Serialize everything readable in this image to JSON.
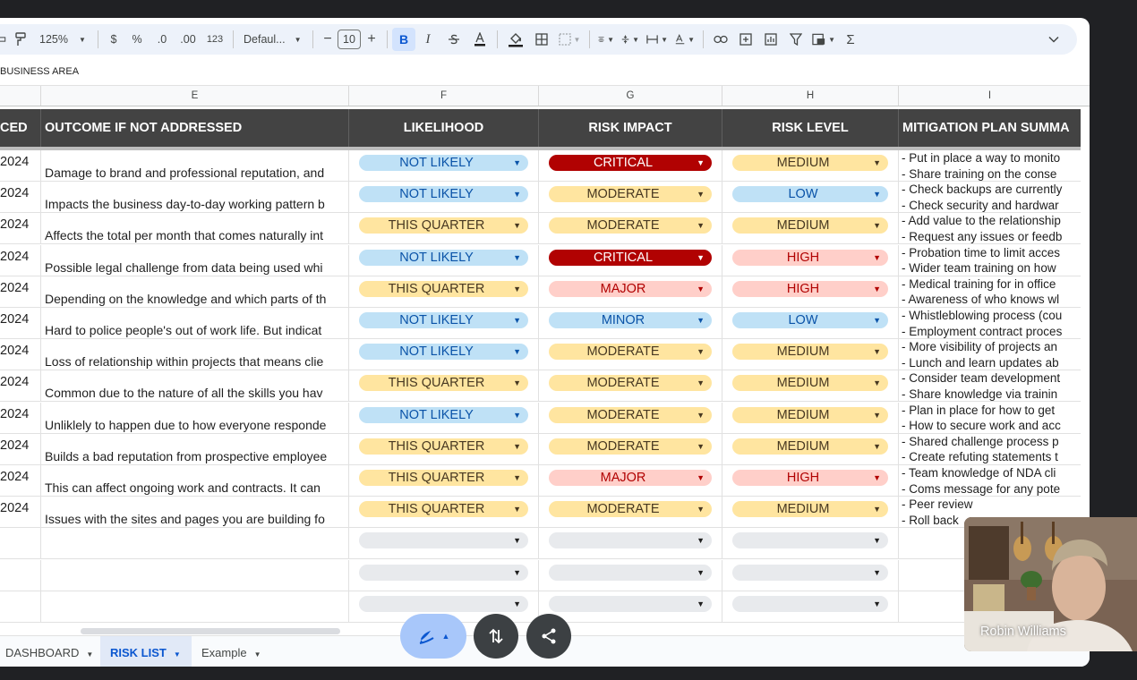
{
  "toolbar": {
    "zoom": "125%",
    "currency": "$",
    "percent": "%",
    "decrease_decimal": ".0",
    "increase_decimal": ".00",
    "number_format": "123",
    "font": "Defaul...",
    "minus": "−",
    "font_size": "10",
    "plus": "+",
    "bold": "B",
    "italic": "I",
    "sum": "Σ"
  },
  "formula_bar": {
    "value": "BUSINESS AREA"
  },
  "columns": {
    "e": "E",
    "f": "F",
    "g": "G",
    "h": "H",
    "i": "I"
  },
  "header": {
    "d": "CED",
    "e": "OUTCOME IF NOT ADDRESSED",
    "f": "LIKELIHOOD",
    "g": "RISK IMPACT",
    "h": "RISK LEVEL",
    "i": "MITIGATION PLAN SUMMA"
  },
  "rows": [
    {
      "d": "2024",
      "e": "Damage to brand and professional reputation, and",
      "f": "NOT LIKELY",
      "g": "CRITICAL",
      "h": "MEDIUM",
      "i1": "- Put in place a way to monito",
      "i2": "- Share training on the conse"
    },
    {
      "d": "2024",
      "e": "Impacts the business day-to-day working pattern b",
      "f": "NOT LIKELY",
      "g": "MODERATE",
      "h": "LOW",
      "i1": "- Check backups are currently",
      "i2": "- Check security and hardwar"
    },
    {
      "d": "2024",
      "e": "Affects the total per month that comes naturally int",
      "f": "THIS QUARTER",
      "g": "MODERATE",
      "h": "MEDIUM",
      "i1": "- Add value to the relationship",
      "i2": "- Request any issues or feedb"
    },
    {
      "d": "2024",
      "e": "Possible legal challenge from data being used whi",
      "f": "NOT LIKELY",
      "g": "CRITICAL",
      "h": "HIGH",
      "i1": "- Probation time to limit acces",
      "i2": "- Wider team training on how"
    },
    {
      "d": "2024",
      "e": "Depending on the knowledge and which parts of th",
      "f": "THIS QUARTER",
      "g": "MAJOR",
      "h": "HIGH",
      "i1": "- Medical training for in office",
      "i2": "- Awareness of who knows wl"
    },
    {
      "d": "2024",
      "e": "Hard to police people's out of work life. But indicat",
      "f": "NOT LIKELY",
      "g": "MINOR",
      "h": "LOW",
      "i1": "- Whistleblowing process (cou",
      "i2": "- Employment contract proces"
    },
    {
      "d": "2024",
      "e": "Loss of relationship within projects that means clie",
      "f": "NOT LIKELY",
      "g": "MODERATE",
      "h": "MEDIUM",
      "i1": "- More visibility of projects an",
      "i2": "- Lunch and learn updates ab"
    },
    {
      "d": "2024",
      "e": "Common due to the nature of all the skills you hav",
      "f": "THIS QUARTER",
      "g": "MODERATE",
      "h": "MEDIUM",
      "i1": "- Consider team development",
      "i2": "- Share knowledge via trainin"
    },
    {
      "d": "2024",
      "e": "Unliklely to happen due to how everyone responde",
      "f": "NOT LIKELY",
      "g": "MODERATE",
      "h": "MEDIUM",
      "i1": "- Plan in place for how to get",
      "i2": "- How to secure work and acc"
    },
    {
      "d": "2024",
      "e": "Builds a bad reputation from prospective employee",
      "f": "THIS QUARTER",
      "g": "MODERATE",
      "h": "MEDIUM",
      "i1": "- Shared challenge process p",
      "i2": "- Create refuting statements t"
    },
    {
      "d": "2024",
      "e": "This can affect ongoing work and contracts. It can",
      "f": "THIS QUARTER",
      "g": "MAJOR",
      "h": "HIGH",
      "i1": "- Team knowledge of NDA cli",
      "i2": "- Coms message for any pote"
    },
    {
      "d": "2024",
      "e": "Issues with the sites and pages you are building fo",
      "f": "THIS QUARTER",
      "g": "MODERATE",
      "h": "MEDIUM",
      "i1": "- Peer review",
      "i2": "- Roll back"
    },
    {
      "d": "",
      "e": "",
      "f": "",
      "g": "",
      "h": "",
      "i1": "",
      "i2": ""
    },
    {
      "d": "",
      "e": "",
      "f": "",
      "g": "",
      "h": "",
      "i1": "",
      "i2": ""
    },
    {
      "d": "",
      "e": "",
      "f": "",
      "g": "",
      "h": "",
      "i1": "",
      "i2": ""
    }
  ],
  "pill_colors": {
    "NOT LIKELY": "p-blue",
    "THIS QUARTER": "p-yellow",
    "CRITICAL": "p-red",
    "MODERATE": "p-yellow",
    "MAJOR": "p-pink",
    "MINOR": "p-blue",
    "MEDIUM": "p-yellow",
    "LOW": "p-blue",
    "HIGH": "p-pink",
    "": "p-empty"
  },
  "tabs": [
    {
      "label": "DASHBOARD",
      "active": false
    },
    {
      "label": "RISK LIST",
      "active": true
    },
    {
      "label": "Example",
      "active": false
    }
  ],
  "video": {
    "participant_name": "Robin Williams"
  }
}
